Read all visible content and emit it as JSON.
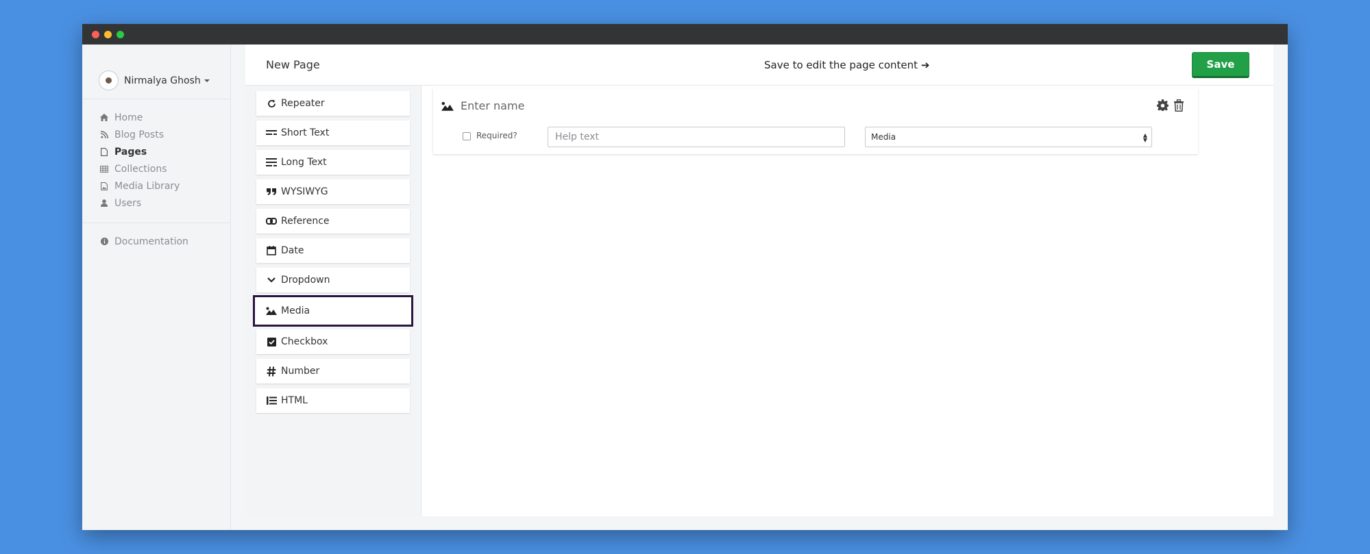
{
  "user": {
    "name": "Nirmalya Ghosh"
  },
  "nav": {
    "items": [
      {
        "label": "Home",
        "icon": "home-icon"
      },
      {
        "label": "Blog Posts",
        "icon": "rss-icon"
      },
      {
        "label": "Pages",
        "icon": "file-icon",
        "active": true
      },
      {
        "label": "Collections",
        "icon": "table-icon"
      },
      {
        "label": "Media Library",
        "icon": "image-file-icon"
      },
      {
        "label": "Users",
        "icon": "user-icon"
      }
    ],
    "documentation": "Documentation"
  },
  "header": {
    "title": "New Page",
    "notice": "Save to edit the page content",
    "notice_arrow": "➔",
    "save_label": "Save"
  },
  "palette": {
    "items": [
      {
        "label": "Repeater",
        "icon": "refresh-icon"
      },
      {
        "label": "Short Text",
        "icon": "short-text-icon"
      },
      {
        "label": "Long Text",
        "icon": "long-text-icon"
      },
      {
        "label": "WYSIWYG",
        "icon": "quote-icon"
      },
      {
        "label": "Reference",
        "icon": "link-icon"
      },
      {
        "label": "Date",
        "icon": "calendar-icon"
      },
      {
        "label": "Dropdown",
        "icon": "chevron-down-icon"
      },
      {
        "label": "Media",
        "icon": "image-icon",
        "selected": true
      },
      {
        "label": "Checkbox",
        "icon": "checkbox-icon"
      },
      {
        "label": "Number",
        "icon": "hash-icon"
      },
      {
        "label": "HTML",
        "icon": "list-icon"
      }
    ]
  },
  "field_card": {
    "name_placeholder": "Enter name",
    "required_label": "Required?",
    "help_placeholder": "Help text",
    "type_value": "Media"
  },
  "colors": {
    "background": "#4a90e2",
    "save_button": "#21a047",
    "selected_outline": "#2a1440"
  }
}
